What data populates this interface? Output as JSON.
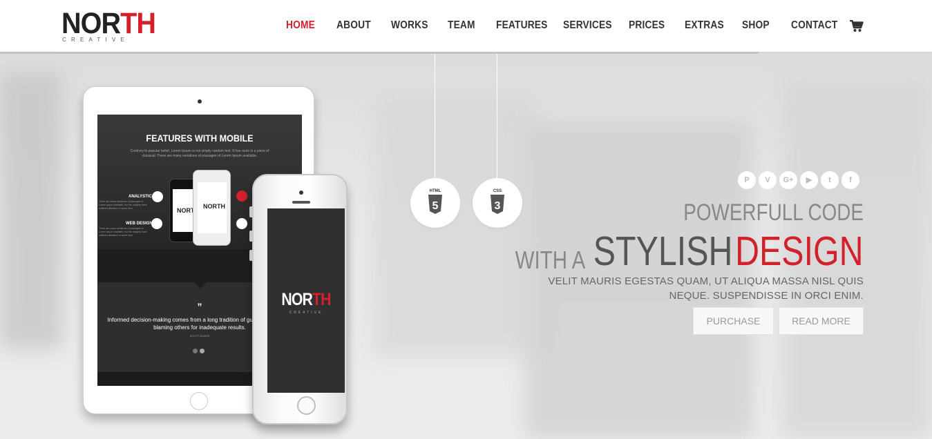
{
  "brand": {
    "name_part1": "NOR",
    "name_part2": "TH",
    "tagline": "CREATIVE"
  },
  "nav": {
    "items": [
      {
        "label": "HOME",
        "active": true
      },
      {
        "label": "ABOUT"
      },
      {
        "label": "WORKS"
      },
      {
        "label": "TEAM"
      },
      {
        "label": "FEATURES"
      },
      {
        "label": "SERVICES"
      },
      {
        "label": "PRICES"
      },
      {
        "label": "EXTRAS"
      },
      {
        "label": "SHOP"
      },
      {
        "label": "CONTACT"
      }
    ],
    "cart_icon": "shopping-cart-icon"
  },
  "badges": [
    {
      "label": "HTML",
      "number": "5",
      "icon": "html5-icon"
    },
    {
      "label": "CSS",
      "number": "3",
      "icon": "css3-icon"
    }
  ],
  "tablet": {
    "title": "FEATURES WITH MOBILE",
    "subtitle": "Contrary to popular belief, Lorem Ipsum is not simply random text. It has roots in a piece of classical. There are many variations of passages of Lorem Ipsum available.",
    "feature1": "ANALYSTIC",
    "feature2": "WEB DESIGN",
    "feature_desc": "There are many variations of passages of Lorem Ipsum available, but the majority have suffered alteration in some form",
    "quote_mark": "”",
    "quote": "Informed decision-making comes from a long tradition of guessing and then blaming others for inadequate results.",
    "author": "SCOTT ADAMS",
    "mini_logo": "NORTH"
  },
  "phone": {
    "logo_part1": "NOR",
    "logo_part2": "TH",
    "logo_sub": "CREATIVE"
  },
  "hero": {
    "socials": [
      "pinterest-icon",
      "vimeo-icon",
      "google-plus-icon",
      "youtube-icon",
      "twitter-icon",
      "facebook-icon"
    ],
    "social_glyphs": [
      "P",
      "V",
      "G+",
      "▶",
      "t",
      "f"
    ],
    "line1": "POWERFULL CODE",
    "line2_pre": "WITH A",
    "line2_mid": "STYLISH",
    "line2_accent": "DESIGN",
    "description": "VELIT MAURIS EGESTAS QUAM, UT ALIQUA MASSA NISL QUIS NEQUE. SUSPENDISSE IN ORCI ENIM.",
    "btn_purchase": "PURCHASE",
    "btn_readmore": "READ MORE"
  },
  "colors": {
    "accent": "#d3202a",
    "dark": "#222222",
    "muted": "#888888"
  }
}
